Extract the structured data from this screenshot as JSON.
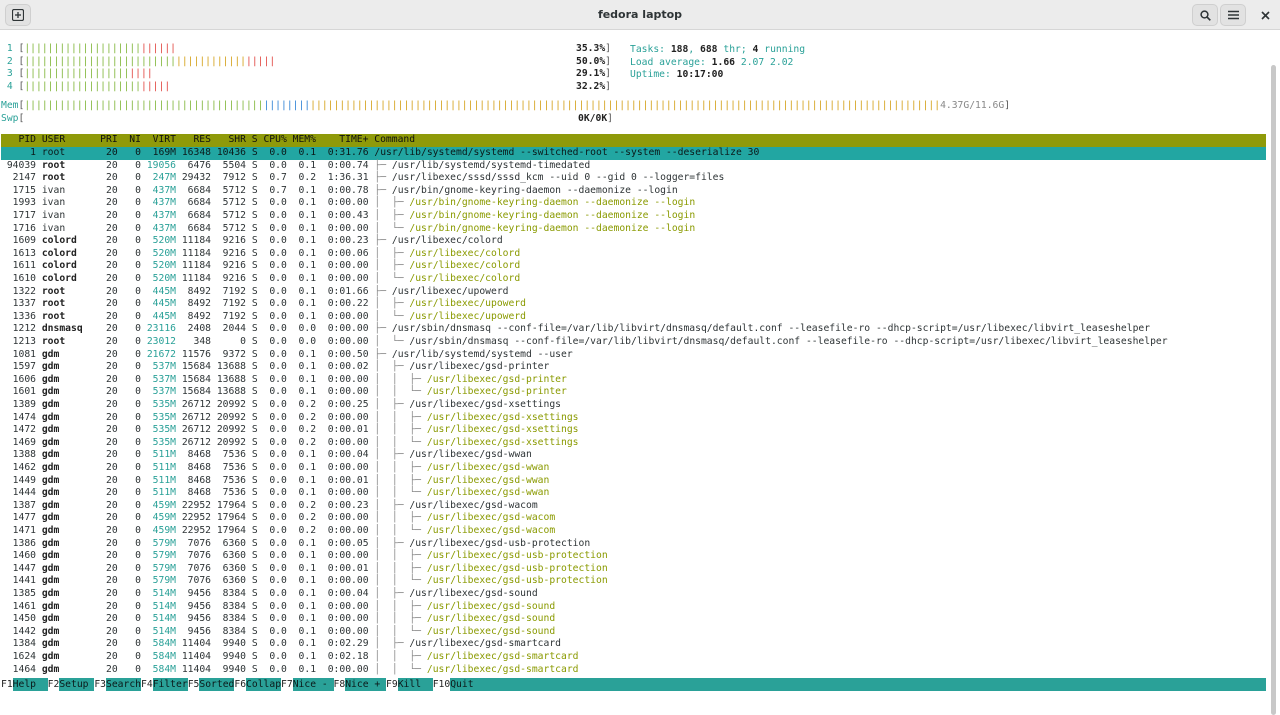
{
  "window": {
    "title": "fedora laptop"
  },
  "cpu_meters": [
    {
      "label": "1",
      "value": "35.3%",
      "g": 20,
      "r": 6,
      "o": 0
    },
    {
      "label": "2",
      "value": "50.0%",
      "g": 26,
      "r": 5,
      "o": 12
    },
    {
      "label": "3",
      "value": "29.1%",
      "g": 18,
      "r": 4,
      "o": 0
    },
    {
      "label": "4",
      "value": "32.2%",
      "g": 20,
      "r": 5,
      "o": 0
    }
  ],
  "mem": {
    "label": "Mem",
    "value": "4.37G/11.6G"
  },
  "swp": {
    "label": "Swp",
    "value": "0K/0K"
  },
  "tasks": {
    "label": "Tasks:",
    "count": "188",
    "thr": "688",
    "thr_label": "thr;",
    "running": "4",
    "running_label": "running"
  },
  "load": {
    "label": "Load average:",
    "v1": "1.66",
    "v2": "2.07",
    "v3": "2.02"
  },
  "uptime": {
    "label": "Uptime:",
    "value": "10:17:00"
  },
  "columns": [
    "PID",
    "USER",
    "PRI",
    "NI",
    "VIRT",
    "RES",
    "SHR",
    "S",
    "CPU%",
    "MEM%",
    "TIME+",
    "Command"
  ],
  "processes": [
    {
      "pid": "1",
      "user": "root",
      "pri": "20",
      "ni": "0",
      "virt": "169M",
      "res": "16348",
      "shr": "10436",
      "s": "S",
      "cpu": "0.0",
      "mem": "0.1",
      "time": "0:31.76",
      "tree": "",
      "cmd": "/usr/lib/systemd/systemd --switched-root --system --deserialize 30",
      "thread": false
    },
    {
      "pid": "94039",
      "user": "root",
      "pri": "20",
      "ni": "0",
      "virt": "19056",
      "res": "6476",
      "shr": "5504",
      "s": "S",
      "cpu": "0.0",
      "mem": "0.1",
      "time": "0:00.74",
      "tree": "├─ ",
      "cmd": "/usr/lib/systemd/systemd-timedated",
      "thread": false
    },
    {
      "pid": "2147",
      "user": "root",
      "pri": "20",
      "ni": "0",
      "virt": "247M",
      "res": "29432",
      "shr": "7912",
      "s": "S",
      "cpu": "0.7",
      "mem": "0.2",
      "time": "1:36.31",
      "tree": "├─ ",
      "cmd": "/usr/libexec/sssd/sssd_kcm --uid 0 --gid 0 --logger=files",
      "thread": false
    },
    {
      "pid": "1715",
      "user": "ivan",
      "pri": "20",
      "ni": "0",
      "virt": "437M",
      "res": "6684",
      "shr": "5712",
      "s": "S",
      "cpu": "0.7",
      "mem": "0.1",
      "time": "0:00.78",
      "tree": "├─ ",
      "cmd": "/usr/bin/gnome-keyring-daemon --daemonize --login",
      "thread": false
    },
    {
      "pid": "1993",
      "user": "ivan",
      "pri": "20",
      "ni": "0",
      "virt": "437M",
      "res": "6684",
      "shr": "5712",
      "s": "S",
      "cpu": "0.0",
      "mem": "0.1",
      "time": "0:00.00",
      "tree": "│  ├─ ",
      "cmd": "/usr/bin/gnome-keyring-daemon --daemonize --login",
      "thread": true
    },
    {
      "pid": "1717",
      "user": "ivan",
      "pri": "20",
      "ni": "0",
      "virt": "437M",
      "res": "6684",
      "shr": "5712",
      "s": "S",
      "cpu": "0.0",
      "mem": "0.1",
      "time": "0:00.43",
      "tree": "│  ├─ ",
      "cmd": "/usr/bin/gnome-keyring-daemon --daemonize --login",
      "thread": true
    },
    {
      "pid": "1716",
      "user": "ivan",
      "pri": "20",
      "ni": "0",
      "virt": "437M",
      "res": "6684",
      "shr": "5712",
      "s": "S",
      "cpu": "0.0",
      "mem": "0.1",
      "time": "0:00.00",
      "tree": "│  └─ ",
      "cmd": "/usr/bin/gnome-keyring-daemon --daemonize --login",
      "thread": true
    },
    {
      "pid": "1609",
      "user": "colord",
      "pri": "20",
      "ni": "0",
      "virt": "520M",
      "res": "11184",
      "shr": "9216",
      "s": "S",
      "cpu": "0.0",
      "mem": "0.1",
      "time": "0:00.23",
      "tree": "├─ ",
      "cmd": "/usr/libexec/colord",
      "thread": false
    },
    {
      "pid": "1613",
      "user": "colord",
      "pri": "20",
      "ni": "0",
      "virt": "520M",
      "res": "11184",
      "shr": "9216",
      "s": "S",
      "cpu": "0.0",
      "mem": "0.1",
      "time": "0:00.06",
      "tree": "│  ├─ ",
      "cmd": "/usr/libexec/colord",
      "thread": true
    },
    {
      "pid": "1611",
      "user": "colord",
      "pri": "20",
      "ni": "0",
      "virt": "520M",
      "res": "11184",
      "shr": "9216",
      "s": "S",
      "cpu": "0.0",
      "mem": "0.1",
      "time": "0:00.00",
      "tree": "│  ├─ ",
      "cmd": "/usr/libexec/colord",
      "thread": true
    },
    {
      "pid": "1610",
      "user": "colord",
      "pri": "20",
      "ni": "0",
      "virt": "520M",
      "res": "11184",
      "shr": "9216",
      "s": "S",
      "cpu": "0.0",
      "mem": "0.1",
      "time": "0:00.00",
      "tree": "│  └─ ",
      "cmd": "/usr/libexec/colord",
      "thread": true
    },
    {
      "pid": "1322",
      "user": "root",
      "pri": "20",
      "ni": "0",
      "virt": "445M",
      "res": "8492",
      "shr": "7192",
      "s": "S",
      "cpu": "0.0",
      "mem": "0.1",
      "time": "0:01.66",
      "tree": "├─ ",
      "cmd": "/usr/libexec/upowerd",
      "thread": false
    },
    {
      "pid": "1337",
      "user": "root",
      "pri": "20",
      "ni": "0",
      "virt": "445M",
      "res": "8492",
      "shr": "7192",
      "s": "S",
      "cpu": "0.0",
      "mem": "0.1",
      "time": "0:00.22",
      "tree": "│  ├─ ",
      "cmd": "/usr/libexec/upowerd",
      "thread": true
    },
    {
      "pid": "1336",
      "user": "root",
      "pri": "20",
      "ni": "0",
      "virt": "445M",
      "res": "8492",
      "shr": "7192",
      "s": "S",
      "cpu": "0.0",
      "mem": "0.1",
      "time": "0:00.00",
      "tree": "│  └─ ",
      "cmd": "/usr/libexec/upowerd",
      "thread": true
    },
    {
      "pid": "1212",
      "user": "dnsmasq",
      "pri": "20",
      "ni": "0",
      "virt": "23116",
      "res": "2408",
      "shr": "2044",
      "s": "S",
      "cpu": "0.0",
      "mem": "0.0",
      "time": "0:00.00",
      "tree": "├─ ",
      "cmd": "/usr/sbin/dnsmasq --conf-file=/var/lib/libvirt/dnsmasq/default.conf --leasefile-ro --dhcp-script=/usr/libexec/libvirt_leaseshelper",
      "thread": false
    },
    {
      "pid": "1213",
      "user": "root",
      "pri": "20",
      "ni": "0",
      "virt": "23012",
      "res": "348",
      "shr": "0",
      "s": "S",
      "cpu": "0.0",
      "mem": "0.0",
      "time": "0:00.00",
      "tree": "│  └─ ",
      "cmd": "/usr/sbin/dnsmasq --conf-file=/var/lib/libvirt/dnsmasq/default.conf --leasefile-ro --dhcp-script=/usr/libexec/libvirt_leaseshelper",
      "thread": false
    },
    {
      "pid": "1081",
      "user": "gdm",
      "pri": "20",
      "ni": "0",
      "virt": "21672",
      "res": "11576",
      "shr": "9372",
      "s": "S",
      "cpu": "0.0",
      "mem": "0.1",
      "time": "0:00.50",
      "tree": "├─ ",
      "cmd": "/usr/lib/systemd/systemd --user",
      "thread": false
    },
    {
      "pid": "1597",
      "user": "gdm",
      "pri": "20",
      "ni": "0",
      "virt": "537M",
      "res": "15684",
      "shr": "13688",
      "s": "S",
      "cpu": "0.0",
      "mem": "0.1",
      "time": "0:00.02",
      "tree": "│  ├─ ",
      "cmd": "/usr/libexec/gsd-printer",
      "thread": false
    },
    {
      "pid": "1606",
      "user": "gdm",
      "pri": "20",
      "ni": "0",
      "virt": "537M",
      "res": "15684",
      "shr": "13688",
      "s": "S",
      "cpu": "0.0",
      "mem": "0.1",
      "time": "0:00.00",
      "tree": "│  │  ├─ ",
      "cmd": "/usr/libexec/gsd-printer",
      "thread": true
    },
    {
      "pid": "1601",
      "user": "gdm",
      "pri": "20",
      "ni": "0",
      "virt": "537M",
      "res": "15684",
      "shr": "13688",
      "s": "S",
      "cpu": "0.0",
      "mem": "0.1",
      "time": "0:00.00",
      "tree": "│  │  └─ ",
      "cmd": "/usr/libexec/gsd-printer",
      "thread": true
    },
    {
      "pid": "1389",
      "user": "gdm",
      "pri": "20",
      "ni": "0",
      "virt": "535M",
      "res": "26712",
      "shr": "20992",
      "s": "S",
      "cpu": "0.0",
      "mem": "0.2",
      "time": "0:00.25",
      "tree": "│  ├─ ",
      "cmd": "/usr/libexec/gsd-xsettings",
      "thread": false
    },
    {
      "pid": "1474",
      "user": "gdm",
      "pri": "20",
      "ni": "0",
      "virt": "535M",
      "res": "26712",
      "shr": "20992",
      "s": "S",
      "cpu": "0.0",
      "mem": "0.2",
      "time": "0:00.00",
      "tree": "│  │  ├─ ",
      "cmd": "/usr/libexec/gsd-xsettings",
      "thread": true
    },
    {
      "pid": "1472",
      "user": "gdm",
      "pri": "20",
      "ni": "0",
      "virt": "535M",
      "res": "26712",
      "shr": "20992",
      "s": "S",
      "cpu": "0.0",
      "mem": "0.2",
      "time": "0:00.01",
      "tree": "│  │  ├─ ",
      "cmd": "/usr/libexec/gsd-xsettings",
      "thread": true
    },
    {
      "pid": "1469",
      "user": "gdm",
      "pri": "20",
      "ni": "0",
      "virt": "535M",
      "res": "26712",
      "shr": "20992",
      "s": "S",
      "cpu": "0.0",
      "mem": "0.2",
      "time": "0:00.00",
      "tree": "│  │  └─ ",
      "cmd": "/usr/libexec/gsd-xsettings",
      "thread": true
    },
    {
      "pid": "1388",
      "user": "gdm",
      "pri": "20",
      "ni": "0",
      "virt": "511M",
      "res": "8468",
      "shr": "7536",
      "s": "S",
      "cpu": "0.0",
      "mem": "0.1",
      "time": "0:00.04",
      "tree": "│  ├─ ",
      "cmd": "/usr/libexec/gsd-wwan",
      "thread": false
    },
    {
      "pid": "1462",
      "user": "gdm",
      "pri": "20",
      "ni": "0",
      "virt": "511M",
      "res": "8468",
      "shr": "7536",
      "s": "S",
      "cpu": "0.0",
      "mem": "0.1",
      "time": "0:00.00",
      "tree": "│  │  ├─ ",
      "cmd": "/usr/libexec/gsd-wwan",
      "thread": true
    },
    {
      "pid": "1449",
      "user": "gdm",
      "pri": "20",
      "ni": "0",
      "virt": "511M",
      "res": "8468",
      "shr": "7536",
      "s": "S",
      "cpu": "0.0",
      "mem": "0.1",
      "time": "0:00.01",
      "tree": "│  │  ├─ ",
      "cmd": "/usr/libexec/gsd-wwan",
      "thread": true
    },
    {
      "pid": "1444",
      "user": "gdm",
      "pri": "20",
      "ni": "0",
      "virt": "511M",
      "res": "8468",
      "shr": "7536",
      "s": "S",
      "cpu": "0.0",
      "mem": "0.1",
      "time": "0:00.00",
      "tree": "│  │  └─ ",
      "cmd": "/usr/libexec/gsd-wwan",
      "thread": true
    },
    {
      "pid": "1387",
      "user": "gdm",
      "pri": "20",
      "ni": "0",
      "virt": "459M",
      "res": "22952",
      "shr": "17964",
      "s": "S",
      "cpu": "0.0",
      "mem": "0.2",
      "time": "0:00.23",
      "tree": "│  ├─ ",
      "cmd": "/usr/libexec/gsd-wacom",
      "thread": false
    },
    {
      "pid": "1477",
      "user": "gdm",
      "pri": "20",
      "ni": "0",
      "virt": "459M",
      "res": "22952",
      "shr": "17964",
      "s": "S",
      "cpu": "0.0",
      "mem": "0.2",
      "time": "0:00.00",
      "tree": "│  │  ├─ ",
      "cmd": "/usr/libexec/gsd-wacom",
      "thread": true
    },
    {
      "pid": "1471",
      "user": "gdm",
      "pri": "20",
      "ni": "0",
      "virt": "459M",
      "res": "22952",
      "shr": "17964",
      "s": "S",
      "cpu": "0.0",
      "mem": "0.2",
      "time": "0:00.00",
      "tree": "│  │  └─ ",
      "cmd": "/usr/libexec/gsd-wacom",
      "thread": true
    },
    {
      "pid": "1386",
      "user": "gdm",
      "pri": "20",
      "ni": "0",
      "virt": "579M",
      "res": "7076",
      "shr": "6360",
      "s": "S",
      "cpu": "0.0",
      "mem": "0.1",
      "time": "0:00.05",
      "tree": "│  ├─ ",
      "cmd": "/usr/libexec/gsd-usb-protection",
      "thread": false
    },
    {
      "pid": "1460",
      "user": "gdm",
      "pri": "20",
      "ni": "0",
      "virt": "579M",
      "res": "7076",
      "shr": "6360",
      "s": "S",
      "cpu": "0.0",
      "mem": "0.1",
      "time": "0:00.00",
      "tree": "│  │  ├─ ",
      "cmd": "/usr/libexec/gsd-usb-protection",
      "thread": true
    },
    {
      "pid": "1447",
      "user": "gdm",
      "pri": "20",
      "ni": "0",
      "virt": "579M",
      "res": "7076",
      "shr": "6360",
      "s": "S",
      "cpu": "0.0",
      "mem": "0.1",
      "time": "0:00.01",
      "tree": "│  │  ├─ ",
      "cmd": "/usr/libexec/gsd-usb-protection",
      "thread": true
    },
    {
      "pid": "1441",
      "user": "gdm",
      "pri": "20",
      "ni": "0",
      "virt": "579M",
      "res": "7076",
      "shr": "6360",
      "s": "S",
      "cpu": "0.0",
      "mem": "0.1",
      "time": "0:00.00",
      "tree": "│  │  └─ ",
      "cmd": "/usr/libexec/gsd-usb-protection",
      "thread": true
    },
    {
      "pid": "1385",
      "user": "gdm",
      "pri": "20",
      "ni": "0",
      "virt": "514M",
      "res": "9456",
      "shr": "8384",
      "s": "S",
      "cpu": "0.0",
      "mem": "0.1",
      "time": "0:00.04",
      "tree": "│  ├─ ",
      "cmd": "/usr/libexec/gsd-sound",
      "thread": false
    },
    {
      "pid": "1461",
      "user": "gdm",
      "pri": "20",
      "ni": "0",
      "virt": "514M",
      "res": "9456",
      "shr": "8384",
      "s": "S",
      "cpu": "0.0",
      "mem": "0.1",
      "time": "0:00.00",
      "tree": "│  │  ├─ ",
      "cmd": "/usr/libexec/gsd-sound",
      "thread": true
    },
    {
      "pid": "1450",
      "user": "gdm",
      "pri": "20",
      "ni": "0",
      "virt": "514M",
      "res": "9456",
      "shr": "8384",
      "s": "S",
      "cpu": "0.0",
      "mem": "0.1",
      "time": "0:00.00",
      "tree": "│  │  ├─ ",
      "cmd": "/usr/libexec/gsd-sound",
      "thread": true
    },
    {
      "pid": "1442",
      "user": "gdm",
      "pri": "20",
      "ni": "0",
      "virt": "514M",
      "res": "9456",
      "shr": "8384",
      "s": "S",
      "cpu": "0.0",
      "mem": "0.1",
      "time": "0:00.00",
      "tree": "│  │  └─ ",
      "cmd": "/usr/libexec/gsd-sound",
      "thread": true
    },
    {
      "pid": "1384",
      "user": "gdm",
      "pri": "20",
      "ni": "0",
      "virt": "584M",
      "res": "11404",
      "shr": "9940",
      "s": "S",
      "cpu": "0.0",
      "mem": "0.1",
      "time": "0:02.29",
      "tree": "│  ├─ ",
      "cmd": "/usr/libexec/gsd-smartcard",
      "thread": false
    },
    {
      "pid": "1624",
      "user": "gdm",
      "pri": "20",
      "ni": "0",
      "virt": "584M",
      "res": "11404",
      "shr": "9940",
      "s": "S",
      "cpu": "0.0",
      "mem": "0.1",
      "time": "0:02.18",
      "tree": "│  │  ├─ ",
      "cmd": "/usr/libexec/gsd-smartcard",
      "thread": true
    },
    {
      "pid": "1464",
      "user": "gdm",
      "pri": "20",
      "ni": "0",
      "virt": "584M",
      "res": "11404",
      "shr": "9940",
      "s": "S",
      "cpu": "0.0",
      "mem": "0.1",
      "time": "0:00.00",
      "tree": "│  │  └─ ",
      "cmd": "/usr/libexec/gsd-smartcard",
      "thread": true
    }
  ],
  "function_keys": [
    {
      "key": "F1",
      "label": "Help  "
    },
    {
      "key": "F2",
      "label": "Setup "
    },
    {
      "key": "F3",
      "label": "Search"
    },
    {
      "key": "F4",
      "label": "Filter"
    },
    {
      "key": "F5",
      "label": "Sorted"
    },
    {
      "key": "F6",
      "label": "Collap"
    },
    {
      "key": "F7",
      "label": "Nice - "
    },
    {
      "key": "F8",
      "label": "Nice + "
    },
    {
      "key": "F9",
      "label": "Kill  "
    },
    {
      "key": "F10",
      "label": "Quit  "
    }
  ],
  "icons": {
    "new_tab": "new-tab-icon",
    "search": "search-icon",
    "menu": "hamburger-menu-icon",
    "close": "close-icon"
  }
}
